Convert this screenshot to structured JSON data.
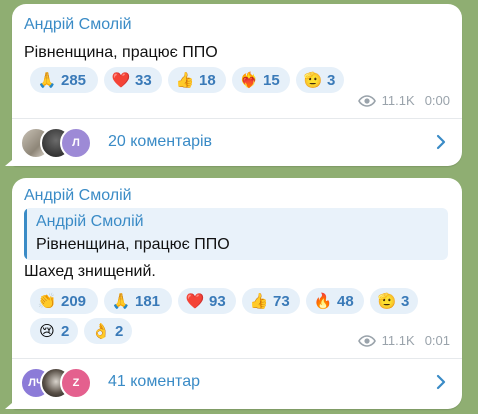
{
  "message1": {
    "author": "Андрій Смолій",
    "text": "Рівненщина, працює ППО",
    "reactions": [
      {
        "emoji": "🙏",
        "count": "285"
      },
      {
        "emoji": "❤️",
        "count": "33"
      },
      {
        "emoji": "👍",
        "count": "18"
      },
      {
        "emoji": "❤️‍🔥",
        "count": "15"
      },
      {
        "emoji": "🫡",
        "count": "3"
      }
    ],
    "views": "11.1K",
    "time": "0:00",
    "comments_label": "20 коментарів",
    "avatar_letter": "Л"
  },
  "message2": {
    "author": "Андрій Смолій",
    "reply": {
      "author": "Андрій Смолій",
      "text": "Рівненщина, працює ППО"
    },
    "text": "Шахед знищений.",
    "reactions_row1": [
      {
        "emoji": "👏",
        "count": "209"
      },
      {
        "emoji": "🙏",
        "count": "181"
      },
      {
        "emoji": "❤️",
        "count": "93"
      },
      {
        "emoji": "👍",
        "count": "73"
      },
      {
        "emoji": "🔥",
        "count": "48"
      },
      {
        "emoji": "🫡",
        "count": "3"
      }
    ],
    "reactions_row2": [
      {
        "emoji": "😢",
        "count": "2"
      },
      {
        "emoji": "👌",
        "count": "2"
      }
    ],
    "views": "11.1K",
    "time": "0:01",
    "comments_label": "41 коментар",
    "avatar_letters": [
      "ЛЧ",
      "Z"
    ]
  },
  "colors": {
    "background": "#8fae72",
    "accent": "#3a8bc6",
    "reaction_bg": "#e6f0f9"
  },
  "icons": [
    "eye-icon",
    "chevron-right-icon"
  ]
}
